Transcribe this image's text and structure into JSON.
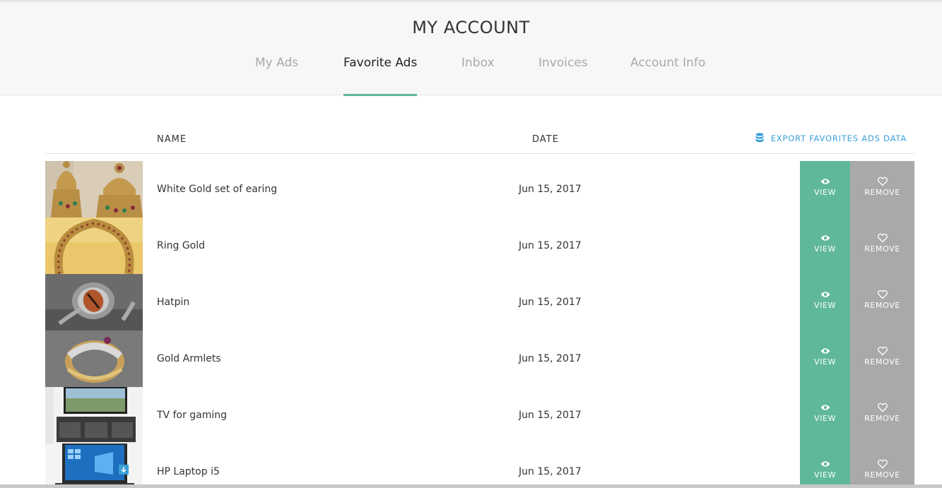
{
  "header": {
    "title": "MY ACCOUNT",
    "tabs": [
      {
        "label": "My Ads"
      },
      {
        "label": "Favorite Ads"
      },
      {
        "label": "Inbox"
      },
      {
        "label": "Invoices"
      },
      {
        "label": "Account Info"
      }
    ],
    "active_tab": "Favorite Ads"
  },
  "table": {
    "col_name": "NAME",
    "col_date": "DATE",
    "export_label": "EXPORT FAVORITES ADS DATA",
    "export_icon": "database-icon",
    "rows": [
      {
        "name": "White Gold set of earing",
        "date": "Jun 15, 2017",
        "view": "VIEW",
        "remove": "REMOVE"
      },
      {
        "name": "Ring Gold",
        "date": "Jun 15, 2017",
        "view": "VIEW",
        "remove": "REMOVE"
      },
      {
        "name": "Hatpin",
        "date": "Jun 15, 2017",
        "view": "VIEW",
        "remove": "REMOVE"
      },
      {
        "name": "Gold Armlets",
        "date": "Jun 15, 2017",
        "view": "VIEW",
        "remove": "REMOVE"
      },
      {
        "name": "TV for gaming",
        "date": "Jun 15, 2017",
        "view": "VIEW",
        "remove": "REMOVE"
      },
      {
        "name": "HP Laptop i5",
        "date": "Jun 15, 2017",
        "view": "VIEW",
        "remove": "REMOVE"
      }
    ]
  },
  "colors": {
    "accent": "#5fb89a",
    "remove_bg": "#a9a9a9",
    "export_link": "#3aa0d8"
  }
}
